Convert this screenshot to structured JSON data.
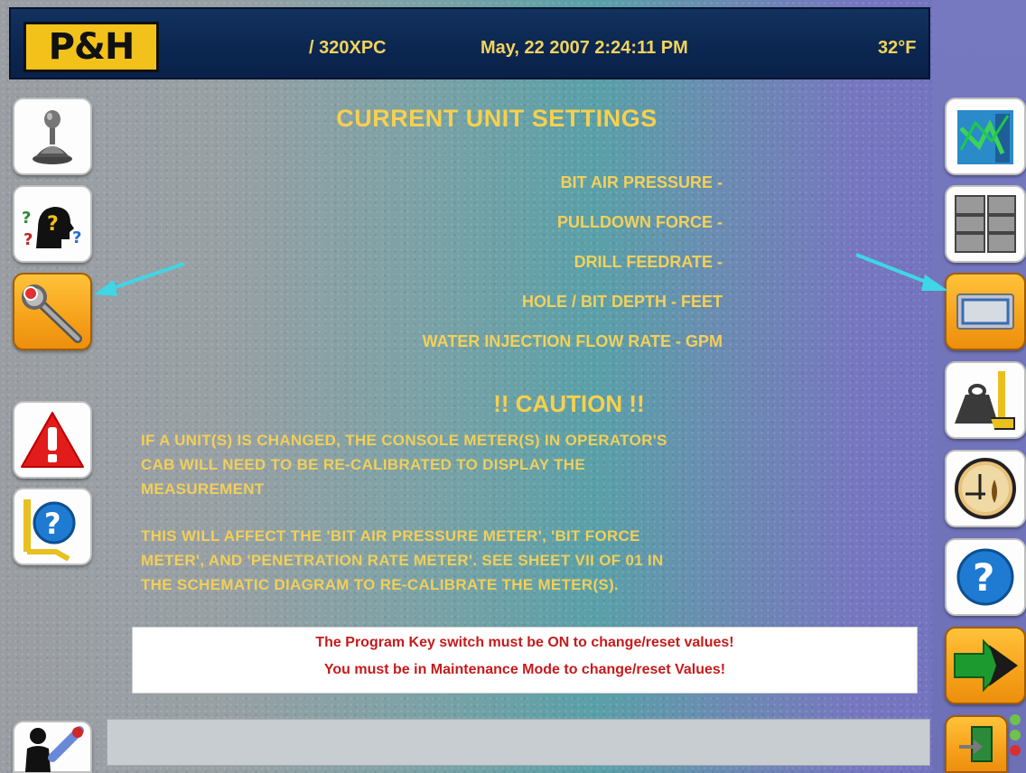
{
  "header": {
    "logo_text": "P&H",
    "model": "/ 320XPC",
    "datetime": "May, 22 2007 2:24:11 PM",
    "temperature": "32°F"
  },
  "left_sidebar": {
    "items": [
      {
        "name": "joystick-icon",
        "active": false
      },
      {
        "name": "help-head-icon",
        "active": false
      },
      {
        "name": "wrench-icon",
        "active": true
      },
      {
        "name": "alarm-warning-icon",
        "active": false
      },
      {
        "name": "drill-help-icon",
        "active": false
      },
      {
        "name": "operator-drill-icon",
        "active": false
      }
    ]
  },
  "right_sidebar": {
    "items": [
      {
        "name": "trend-chart-icon",
        "active": false
      },
      {
        "name": "grid-view-icon",
        "active": false
      },
      {
        "name": "unit-settings-icon",
        "active": true
      },
      {
        "name": "weight-scale-icon",
        "active": false
      },
      {
        "name": "level-gauge-icon",
        "active": false
      },
      {
        "name": "help-icon",
        "active": false
      },
      {
        "name": "next-page-arrow-icon",
        "active": false
      },
      {
        "name": "exit-door-icon",
        "active": false
      }
    ]
  },
  "main": {
    "title": "CURRENT UNIT SETTINGS",
    "settings": [
      {
        "label": "BIT AIR PRESSURE -"
      },
      {
        "label": "PULLDOWN FORCE -"
      },
      {
        "label": "DRILL FEEDRATE -"
      },
      {
        "label": "HOLE / BIT  DEPTH - FEET"
      },
      {
        "label": "WATER INJECTION FLOW RATE - GPM"
      }
    ],
    "caution_title": "!! CAUTION !!",
    "caution_lines_1": [
      "IF A UNIT(S) IS CHANGED, THE CONSOLE METER(S) IN OPERATOR'S",
      "CAB WILL NEED TO BE RE-CALIBRATED TO DISPLAY THE",
      "MEASUREMENT"
    ],
    "caution_lines_2": [
      "THIS WILL AFFECT THE 'BIT AIR PRESSURE METER', 'BIT FORCE",
      "METER', AND 'PENETRATION RATE METER'. SEE SHEET VII OF 01 IN",
      "THE SCHEMATIC DIAGRAM TO RE-CALIBRATE THE METER(S)."
    ]
  },
  "notice": {
    "line1": "The Program Key switch must be ON to change/reset values!",
    "line2": "You must be in Maintenance Mode to change/reset Values!"
  },
  "status_bar": {
    "text": ""
  },
  "colors": {
    "header_bg": "#0b2650",
    "header_text": "#f3d35c",
    "logo_bg": "#f2c21a",
    "title_text": "#f7d04c",
    "notice_text": "#c61b1b",
    "active_button": "#f7a11a",
    "arrow_highlight": "#3fd6e6"
  },
  "status_leds": [
    "#6fc24a",
    "#6fc24a",
    "#d83030"
  ]
}
